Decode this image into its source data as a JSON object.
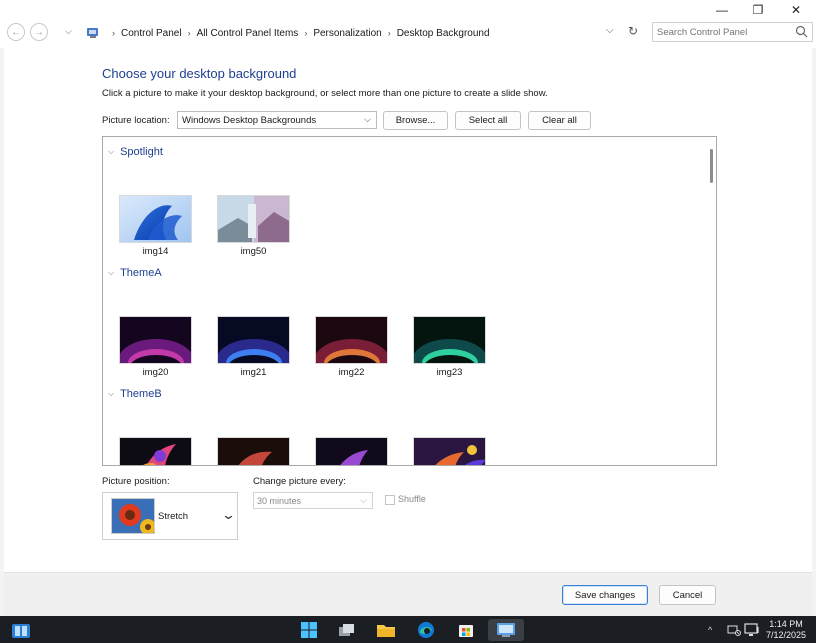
{
  "window": {
    "minimize_glyph": "—",
    "maximize_glyph": "❐",
    "close_glyph": "✕"
  },
  "address_bar": {
    "breadcrumbs": [
      "Control Panel",
      "All Control Panel Items",
      "Personalization",
      "Desktop Background"
    ],
    "search_placeholder": "Search Control Panel"
  },
  "main": {
    "heading": "Choose your desktop background",
    "description": "Click a picture to make it your desktop background, or select more than one picture to create a slide show.",
    "picture_location_label": "Picture location:",
    "picture_location_value": "Windows Desktop Backgrounds",
    "browse_label": "Browse...",
    "select_all_label": "Select all",
    "clear_all_label": "Clear all",
    "groups": [
      {
        "name": "Spotlight",
        "images": [
          "img14",
          "img50"
        ]
      },
      {
        "name": "ThemeA",
        "images": [
          "img20",
          "img21",
          "img22",
          "img23"
        ]
      },
      {
        "name": "ThemeB",
        "images": [
          "",
          "",
          "",
          ""
        ]
      }
    ],
    "picture_position_label": "Picture position:",
    "picture_position_value": "Stretch",
    "change_picture_label": "Change picture every:",
    "change_picture_value": "30 minutes",
    "shuffle_label": "Shuffle"
  },
  "footer": {
    "save_label": "Save changes",
    "cancel_label": "Cancel"
  },
  "taskbar": {
    "time": "1:14 PM",
    "date": "7/12/2025"
  },
  "colors": {
    "heading_blue": "#1e3f8f",
    "taskbar_bg": "#1b1f24",
    "save_border": "#3a7fd6"
  }
}
